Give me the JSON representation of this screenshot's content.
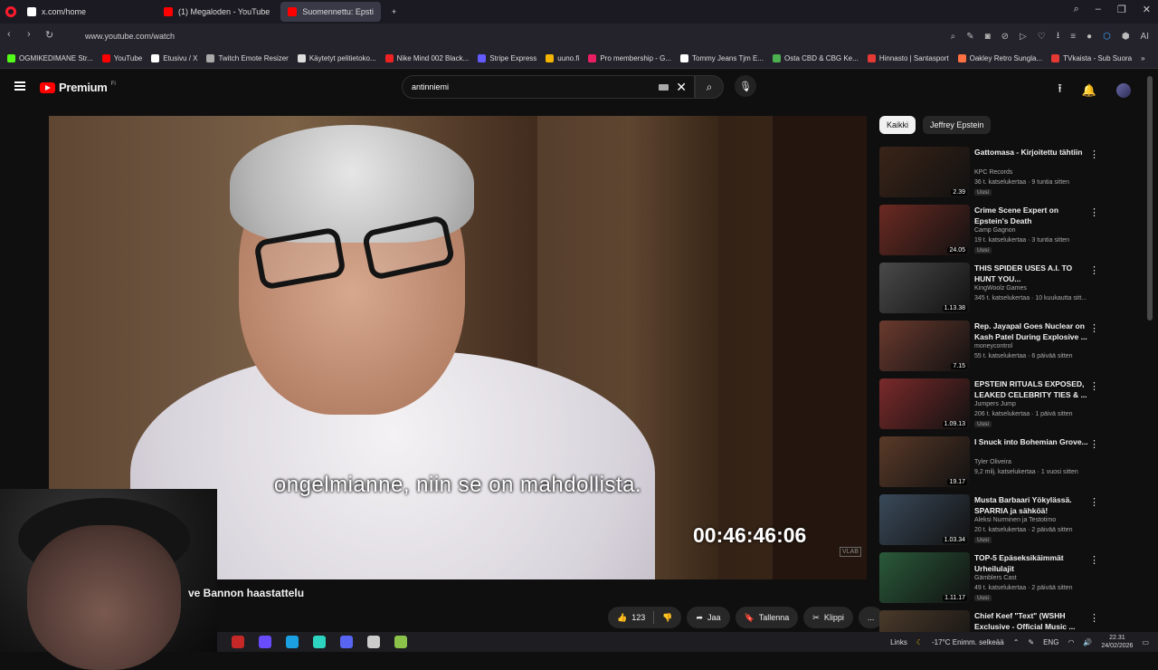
{
  "browser": {
    "tabs": [
      {
        "label": "x.com/home",
        "color": "#ffffff"
      },
      {
        "label": "(1) Megaloden - YouTube",
        "color": "#ff0000"
      },
      {
        "label": "Suomennettu: Epsti",
        "color": "#ff0000"
      }
    ],
    "new_tab": "+",
    "url": "www.youtube.com/watch",
    "ai_label": "AI",
    "bookmarks": [
      {
        "label": "OGMIKEDIMANE Str...",
        "color": "#53fc18"
      },
      {
        "label": "YouTube",
        "color": "#ff0000"
      },
      {
        "label": "Etusivu / X",
        "color": "#ffffff"
      },
      {
        "label": "Twitch Emote Resizer",
        "color": "#aaaaaa"
      },
      {
        "label": "Käytetyt pelitietoko...",
        "color": "#dddddd"
      },
      {
        "label": "Nike Mind 002 Black...",
        "color": "#e22"
      },
      {
        "label": "Stripe Express",
        "color": "#635bff"
      },
      {
        "label": "uuno.fi",
        "color": "#f4b400"
      },
      {
        "label": "Pro membership - G...",
        "color": "#e91e63"
      },
      {
        "label": "Tommy Jeans Tjm E...",
        "color": "#ffffff"
      },
      {
        "label": "Osta CBD & CBG Ke...",
        "color": "#4caf50"
      },
      {
        "label": "Hinnasto | Santasport",
        "color": "#e53935"
      },
      {
        "label": "Oakley Retro Sungla...",
        "color": "#ff7043"
      },
      {
        "label": "TVkaista - Sub Suora",
        "color": "#e53935"
      }
    ]
  },
  "yt": {
    "logo_text": "Premium",
    "logo_region": "FI",
    "search_value": "antinniemi"
  },
  "player": {
    "subtitle": "ongelmianne, niin se on mahdollista.",
    "timecode": "00:46:46:06",
    "watermark": "VLAB"
  },
  "video": {
    "title": "ve Bannon haastattelu",
    "likes": "123",
    "share_label": "Jaa",
    "save_label": "Tallenna",
    "clip_label": "Klippi",
    "more_label": "..."
  },
  "sidebar": {
    "chips": [
      "Kaikki",
      "Jeffrey Epstein"
    ],
    "recs": [
      {
        "title": "Gattomasa - Kirjoitettu tähtiin",
        "channel": "KPC Records",
        "meta": "36 t. katselukertaa · 9 tuntia sitten",
        "badge": "Uusi",
        "duration": "2.39",
        "thumb": "#3a2418"
      },
      {
        "title": "Crime Scene Expert on Epstein's Death",
        "channel": "Camp Gagnon",
        "meta": "19 t. katselukertaa · 3 tuntia sitten",
        "badge": "Uusi",
        "duration": "24.05",
        "thumb": "#6b2a22"
      },
      {
        "title": "THIS SPIDER USES A.I. TO HUNT YOU...",
        "channel": "KingWoolz Games",
        "meta": "345 t. katselukertaa · 10 kuukautta sitt...",
        "badge": "",
        "duration": "1.13.38",
        "thumb": "#4a4a4a"
      },
      {
        "title": "Rep. Jayapal Goes Nuclear on Kash Patel During Explosive ...",
        "channel": "moneycontrol",
        "meta": "55 t. katselukertaa · 6 päivää sitten",
        "badge": "",
        "duration": "7.15",
        "thumb": "#6a3a2e"
      },
      {
        "title": "EPSTEIN RITUALS EXPOSED, LEAKED CELEBRITY TIES & ...",
        "channel": "Jumpers Jump",
        "meta": "206 t. katselukertaa · 1 päivä sitten",
        "badge": "Uusi",
        "duration": "1.09.13",
        "thumb": "#7a2a2a"
      },
      {
        "title": "I Snuck into Bohemian Grove...",
        "channel": "Tyler Oliveira",
        "meta": "9,2 milj. katselukertaa · 1 vuosi sitten",
        "badge": "",
        "duration": "19.17",
        "thumb": "#5a3a28"
      },
      {
        "title": "Musta Barbaari Yökylässä. SPARRIA ja sähköä!",
        "channel": "Aleksi Nurminen ja Testotimo",
        "meta": "20 t. katselukertaa · 2 päivää sitten",
        "badge": "Uusi",
        "duration": "1.03.34",
        "thumb": "#3a4a5a"
      },
      {
        "title": "TOP-5 Epäseksikäimmät Urheilulajit",
        "channel": "Gämblers Cast",
        "meta": "49 t. katselukertaa · 2 päivää sitten",
        "badge": "Uusi",
        "duration": "1.11.17",
        "thumb": "#2a5a3a"
      },
      {
        "title": "Chief Keef \"Text\" (WSHH Exclusive - Official Music ...",
        "channel": "",
        "meta": "",
        "badge": "",
        "duration": "",
        "thumb": "#4a3a2a"
      }
    ]
  },
  "taskbar": {
    "apps": [
      "#c62828",
      "#6a4cff",
      "#1ba1e2",
      "#2dd4bf",
      "#5865f2",
      "#cccccc",
      "#8bc34a"
    ],
    "links": "Links",
    "weather": "-17°C  Enimm. selkeää",
    "lang": "ENG",
    "time": "22.31",
    "date": "24/02/2026"
  }
}
